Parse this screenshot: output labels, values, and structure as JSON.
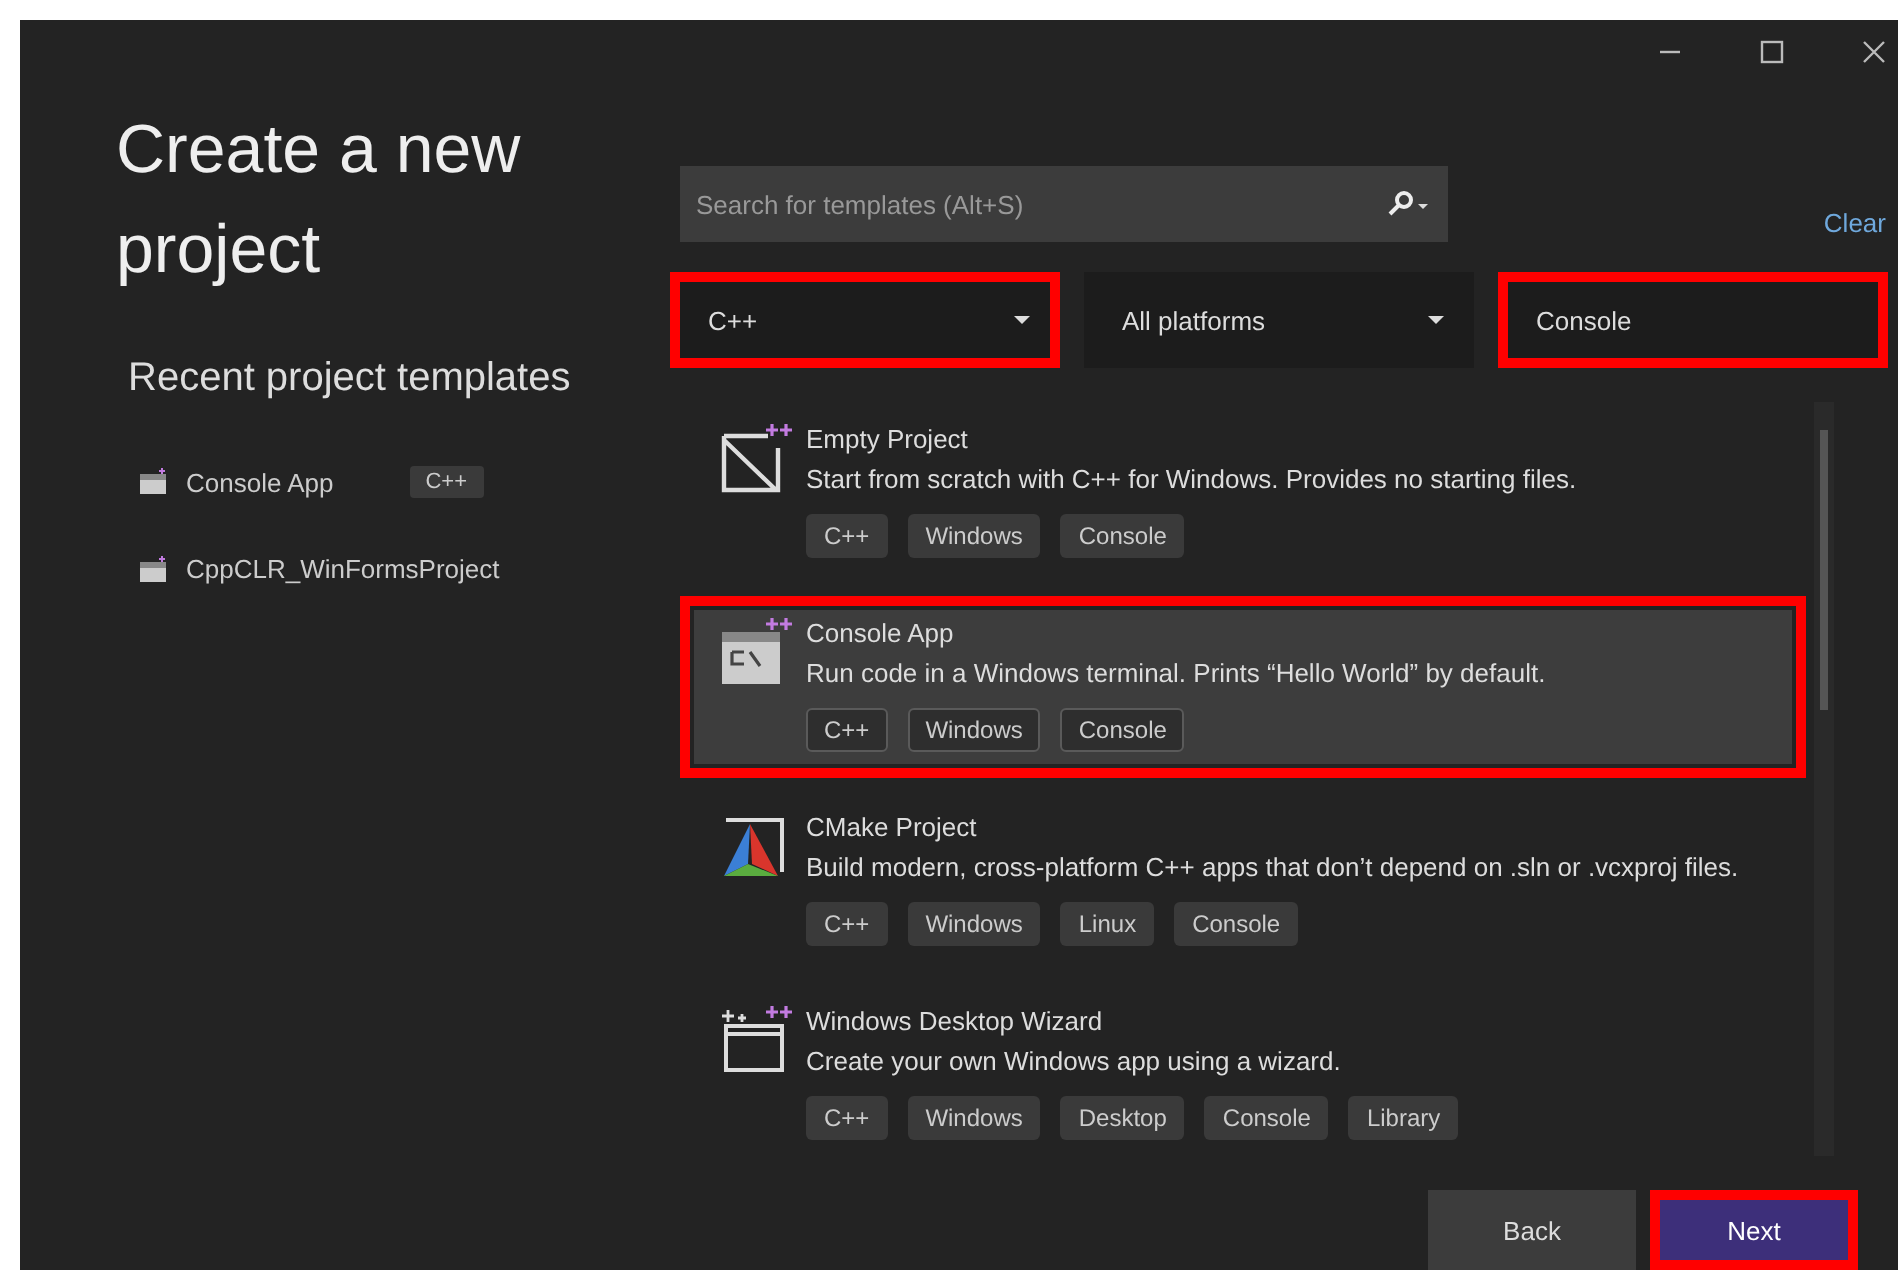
{
  "heading": "Create a new project",
  "recent": {
    "title": "Recent project templates",
    "items": [
      {
        "name": "Console App",
        "tag": "C++"
      },
      {
        "name": "CppCLR_WinFormsProject"
      }
    ]
  },
  "search": {
    "placeholder": "Search for templates (Alt+S)"
  },
  "clear_link": "Clear",
  "filters": [
    {
      "value": "C++",
      "kind": "dropdown",
      "highlighted": true
    },
    {
      "value": "All platforms",
      "kind": "dropdown",
      "highlighted": false
    },
    {
      "value": "Console",
      "kind": "text",
      "highlighted": true
    }
  ],
  "templates": [
    {
      "kind": "empty",
      "title": "Empty Project",
      "description": "Start from scratch with C++ for Windows. Provides no starting files.",
      "tags": [
        "C++",
        "Windows",
        "Console"
      ],
      "selected": false,
      "highlighted": false
    },
    {
      "kind": "console",
      "title": "Console App",
      "description": "Run code in a Windows terminal. Prints “Hello World” by default.",
      "tags": [
        "C++",
        "Windows",
        "Console"
      ],
      "selected": true,
      "highlighted": true
    },
    {
      "kind": "cmake",
      "title": "CMake Project",
      "description": "Build modern, cross-platform C++ apps that don’t depend on .sln or .vcxproj files.",
      "tags": [
        "C++",
        "Windows",
        "Linux",
        "Console"
      ],
      "selected": false,
      "highlighted": false
    },
    {
      "kind": "wizard",
      "title": "Windows Desktop Wizard",
      "description": "Create your own Windows app using a wizard.",
      "tags": [
        "C++",
        "Windows",
        "Desktop",
        "Console",
        "Library"
      ],
      "selected": false,
      "highlighted": false
    }
  ],
  "buttons": [
    {
      "label": "Back",
      "primary": false,
      "highlighted": false
    },
    {
      "label": "Next",
      "primary": true,
      "highlighted": true
    }
  ]
}
